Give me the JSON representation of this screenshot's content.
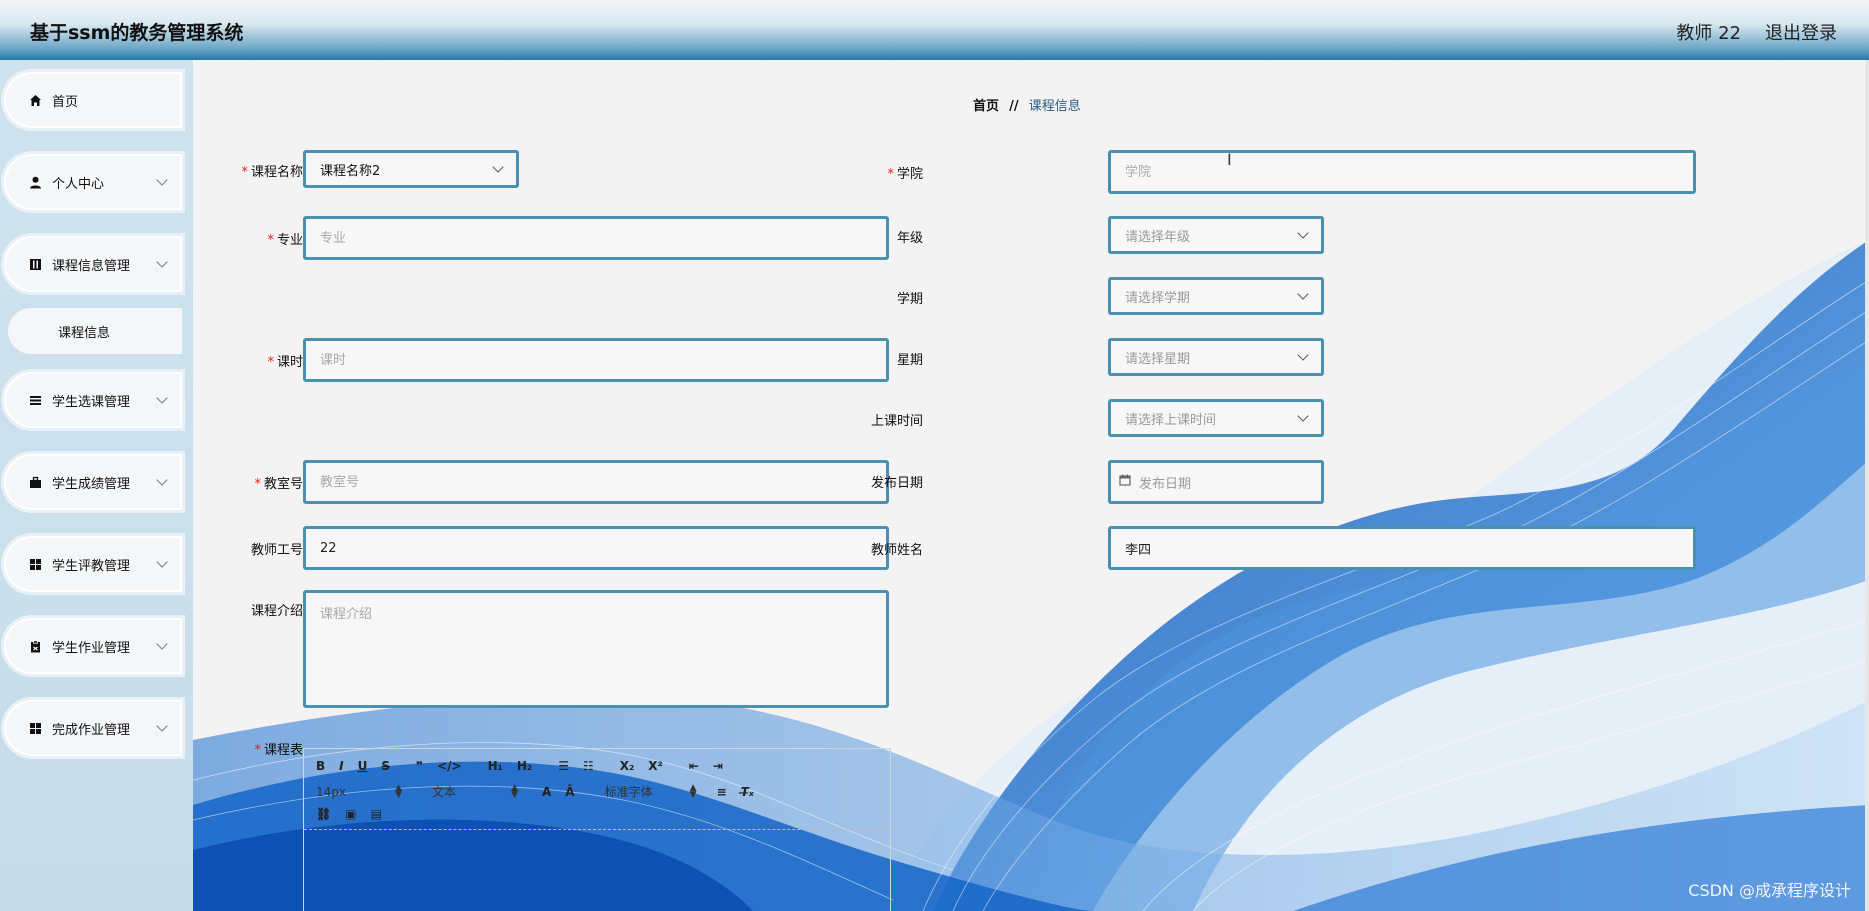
{
  "header": {
    "app_title": "基于ssm的教务管理系统",
    "user": "教师 22",
    "logout": "退出登录"
  },
  "sidebar": {
    "items": [
      {
        "label": "首页",
        "icon": "home-icon"
      },
      {
        "label": "个人中心",
        "icon": "user-icon"
      },
      {
        "label": "课程信息管理",
        "icon": "book-icon"
      },
      {
        "label": "学生选课管理",
        "icon": "list-icon"
      },
      {
        "label": "学生成绩管理",
        "icon": "briefcase-icon"
      },
      {
        "label": "学生评教管理",
        "icon": "grid-icon"
      },
      {
        "label": "学生作业管理",
        "icon": "clipboard-icon"
      },
      {
        "label": "完成作业管理",
        "icon": "grid-icon"
      }
    ],
    "sub_item": "课程信息"
  },
  "breadcrumb": {
    "home": "首页",
    "sep": "//",
    "current": "课程信息"
  },
  "form": {
    "course_name": {
      "label": "课程名称",
      "value": "课程名称2"
    },
    "major": {
      "label": "专业",
      "placeholder": "专业"
    },
    "hours": {
      "label": "课时",
      "placeholder": "课时"
    },
    "classroom": {
      "label": "教室号",
      "placeholder": "教室号"
    },
    "teacher_id": {
      "label": "教师工号",
      "value": "22"
    },
    "intro": {
      "label": "课程介绍",
      "placeholder": "课程介绍"
    },
    "schedule": {
      "label": "课程表"
    },
    "college": {
      "label": "学院",
      "placeholder": "学院"
    },
    "grade": {
      "label": "年级",
      "placeholder": "请选择年级"
    },
    "term": {
      "label": "学期",
      "placeholder": "请选择学期"
    },
    "weekday": {
      "label": "星期",
      "placeholder": "请选择星期"
    },
    "class_time": {
      "label": "上课时间",
      "placeholder": "请选择上课时间"
    },
    "publish_date": {
      "label": "发布日期",
      "placeholder": "发布日期"
    },
    "teacher_name": {
      "label": "教师姓名",
      "value": "李四"
    }
  },
  "editor": {
    "font_size": "14px",
    "block_type": "文本",
    "font_family": "标准字体"
  },
  "watermark": "CSDN @成承程序设计",
  "colors": {
    "input_border": "#4a90b0",
    "accent": "#237aa6",
    "required": "#e02020",
    "wave": "#1565c8"
  }
}
